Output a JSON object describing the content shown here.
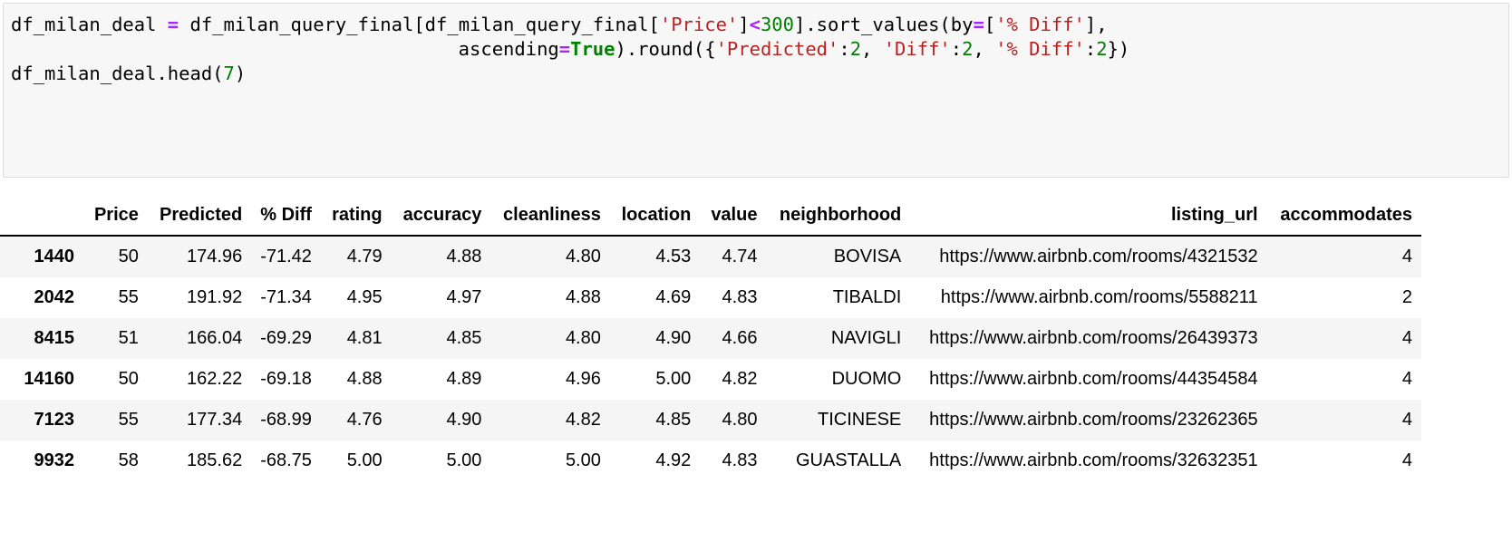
{
  "code_cell": {
    "lines": [
      [
        {
          "t": "df_milan_deal ",
          "c": "plain"
        },
        {
          "t": "=",
          "c": "op"
        },
        {
          "t": " df_milan_query_final[df_milan_query_final[",
          "c": "plain"
        },
        {
          "t": "'Price'",
          "c": "str"
        },
        {
          "t": "]",
          "c": "plain"
        },
        {
          "t": "<",
          "c": "op"
        },
        {
          "t": "300",
          "c": "num"
        },
        {
          "t": "].sort_values(by",
          "c": "plain"
        },
        {
          "t": "=",
          "c": "op"
        },
        {
          "t": "[",
          "c": "plain"
        },
        {
          "t": "'% Diff'",
          "c": "str"
        },
        {
          "t": "],",
          "c": "plain"
        }
      ],
      [
        {
          "t": "                                        ascending",
          "c": "plain"
        },
        {
          "t": "=",
          "c": "op"
        },
        {
          "t": "True",
          "c": "kw"
        },
        {
          "t": ").round({",
          "c": "plain"
        },
        {
          "t": "'Predicted'",
          "c": "str"
        },
        {
          "t": ":",
          "c": "plain"
        },
        {
          "t": "2",
          "c": "num"
        },
        {
          "t": ", ",
          "c": "plain"
        },
        {
          "t": "'Diff'",
          "c": "str"
        },
        {
          "t": ":",
          "c": "plain"
        },
        {
          "t": "2",
          "c": "num"
        },
        {
          "t": ", ",
          "c": "plain"
        },
        {
          "t": "'% Diff'",
          "c": "str"
        },
        {
          "t": ":",
          "c": "plain"
        },
        {
          "t": "2",
          "c": "num"
        },
        {
          "t": "})",
          "c": "plain"
        }
      ],
      [
        {
          "t": "df_milan_deal.head(",
          "c": "plain"
        },
        {
          "t": "7",
          "c": "num"
        },
        {
          "t": ")",
          "c": "plain"
        }
      ]
    ]
  },
  "dataframe": {
    "index_header": "",
    "columns": [
      "Price",
      "Predicted",
      "% Diff",
      "rating",
      "accuracy",
      "cleanliness",
      "location",
      "value",
      "neighborhood",
      "listing_url",
      "accommodates"
    ],
    "index": [
      "1440",
      "2042",
      "8415",
      "14160",
      "7123",
      "9932"
    ],
    "rows": [
      {
        "index": "1440",
        "Price": "50",
        "Predicted": "174.96",
        "% Diff": "-71.42",
        "rating": "4.79",
        "accuracy": "4.88",
        "cleanliness": "4.80",
        "location": "4.53",
        "value": "4.74",
        "neighborhood": "BOVISA",
        "listing_url": "https://www.airbnb.com/rooms/4321532",
        "accommodates": "4"
      },
      {
        "index": "2042",
        "Price": "55",
        "Predicted": "191.92",
        "% Diff": "-71.34",
        "rating": "4.95",
        "accuracy": "4.97",
        "cleanliness": "4.88",
        "location": "4.69",
        "value": "4.83",
        "neighborhood": "TIBALDI",
        "listing_url": "https://www.airbnb.com/rooms/5588211",
        "accommodates": "2"
      },
      {
        "index": "8415",
        "Price": "51",
        "Predicted": "166.04",
        "% Diff": "-69.29",
        "rating": "4.81",
        "accuracy": "4.85",
        "cleanliness": "4.80",
        "location": "4.90",
        "value": "4.66",
        "neighborhood": "NAVIGLI",
        "listing_url": "https://www.airbnb.com/rooms/26439373",
        "accommodates": "4"
      },
      {
        "index": "14160",
        "Price": "50",
        "Predicted": "162.22",
        "% Diff": "-69.18",
        "rating": "4.88",
        "accuracy": "4.89",
        "cleanliness": "4.96",
        "location": "5.00",
        "value": "4.82",
        "neighborhood": "DUOMO",
        "listing_url": "https://www.airbnb.com/rooms/44354584",
        "accommodates": "4"
      },
      {
        "index": "7123",
        "Price": "55",
        "Predicted": "177.34",
        "% Diff": "-68.99",
        "rating": "4.76",
        "accuracy": "4.90",
        "cleanliness": "4.82",
        "location": "4.85",
        "value": "4.80",
        "neighborhood": "TICINESE",
        "listing_url": "https://www.airbnb.com/rooms/23262365",
        "accommodates": "4"
      },
      {
        "index": "9932",
        "Price": "58",
        "Predicted": "185.62",
        "% Diff": "-68.75",
        "rating": "5.00",
        "accuracy": "5.00",
        "cleanliness": "5.00",
        "location": "4.92",
        "value": "4.83",
        "neighborhood": "GUASTALLA",
        "listing_url": "https://www.airbnb.com/rooms/32632351",
        "accommodates": "4"
      }
    ]
  },
  "colors": {
    "string": "#ba2121",
    "number": "#008000",
    "operator": "#aa22ff",
    "keyword": "#008000",
    "cell_background": "#f7f7f7",
    "row_stripe": "#f5f5f5"
  }
}
